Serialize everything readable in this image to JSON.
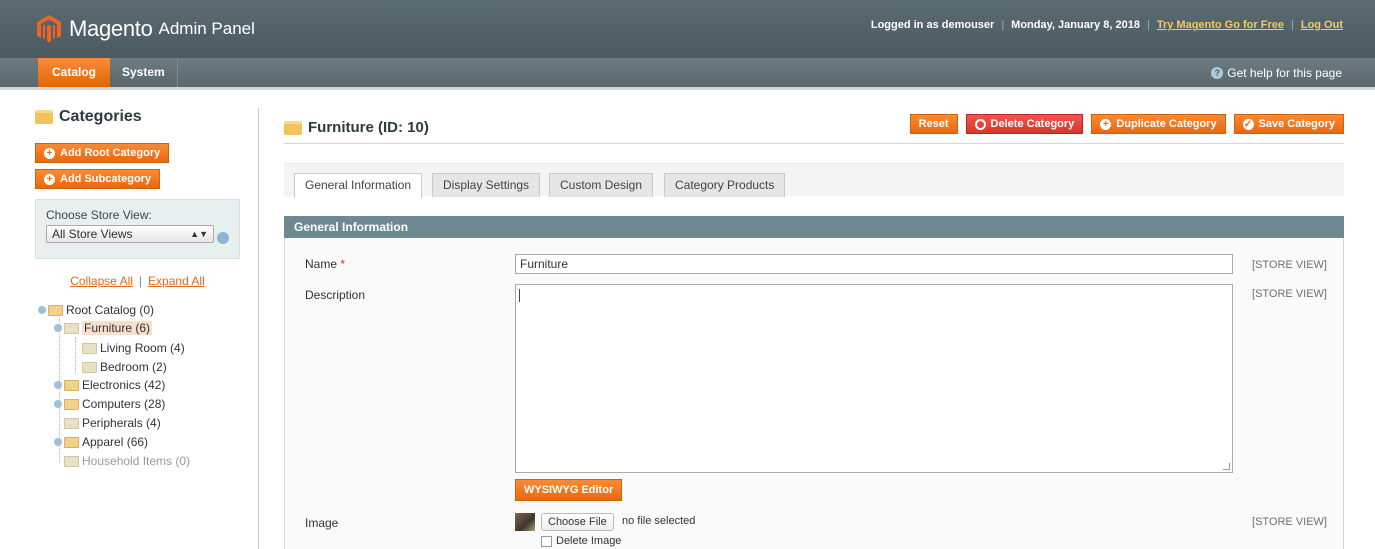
{
  "header": {
    "logo_word": "Magento",
    "logo_sub": "Admin Panel",
    "logged_in": "Logged in as demouser",
    "date": "Monday, January 8, 2018",
    "try_link": "Try Magento Go for Free",
    "logout_link": "Log Out"
  },
  "nav": {
    "catalog": "Catalog",
    "system": "System",
    "help": "Get help for this page"
  },
  "sidebar": {
    "title": "Categories",
    "add_root": "Add Root Category",
    "add_sub": "Add Subcategory",
    "store_label": "Choose Store View:",
    "store_value": "All Store Views",
    "collapse": "Collapse All",
    "expand": "Expand All",
    "tree": [
      {
        "label": "Root Catalog (0)"
      },
      {
        "label": "Furniture (6)"
      },
      {
        "label": "Living Room (4)"
      },
      {
        "label": "Bedroom (2)"
      },
      {
        "label": "Electronics (42)"
      },
      {
        "label": "Computers (28)"
      },
      {
        "label": "Peripherals (4)"
      },
      {
        "label": "Apparel (66)"
      },
      {
        "label": "Household Items (0)"
      }
    ]
  },
  "main": {
    "title": "Furniture (ID: 10)",
    "buttons": {
      "reset": "Reset",
      "delete": "Delete Category",
      "duplicate": "Duplicate Category",
      "save": "Save Category"
    },
    "tabs": [
      {
        "label": "General Information"
      },
      {
        "label": "Display Settings"
      },
      {
        "label": "Custom Design"
      },
      {
        "label": "Category Products"
      }
    ],
    "fieldset_title": "General Information",
    "fields": {
      "name_label": "Name",
      "name_required": "*",
      "name_value": "Furniture",
      "description_label": "Description",
      "description_value": "",
      "wysiwyg": "WYSIWYG Editor",
      "image_label": "Image",
      "choose_file": "Choose File",
      "no_file": "no file selected",
      "delete_image": "Delete Image",
      "scope": "[STORE VIEW]"
    }
  },
  "colors": {
    "header_bg": "#4f5f66",
    "accent_orange": "#eb6b12",
    "danger_red": "#d9352c",
    "fieldset_head": "#6f8992"
  }
}
